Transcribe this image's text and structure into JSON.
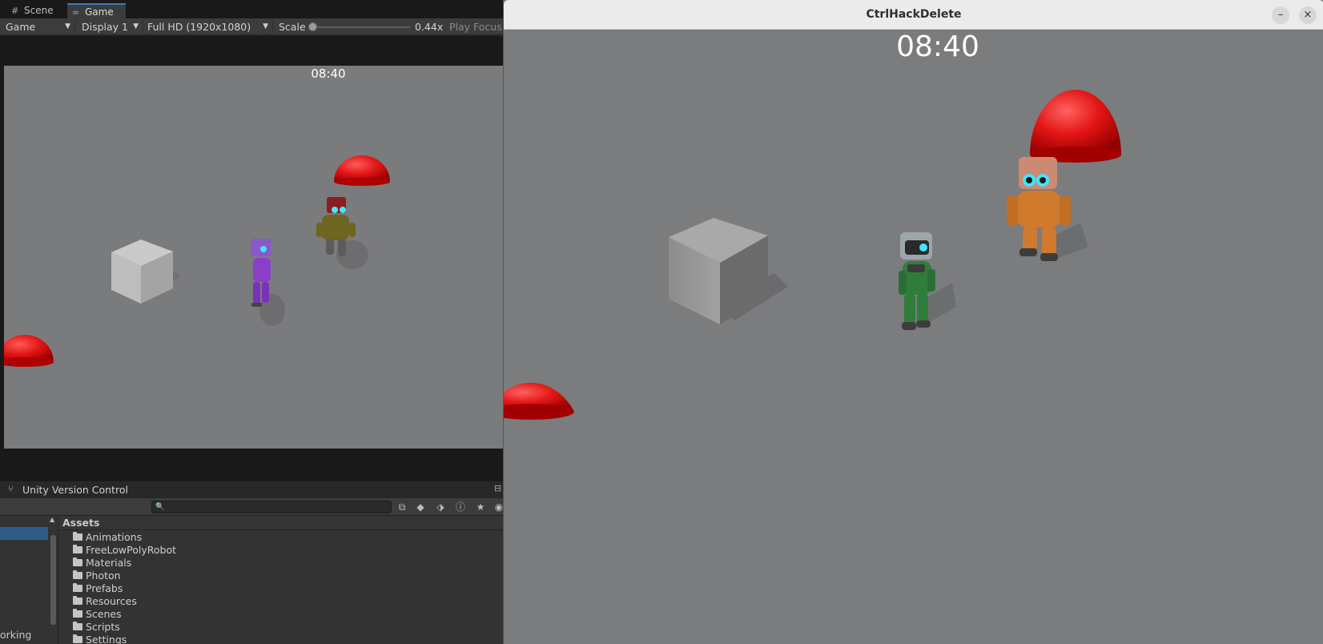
{
  "editor": {
    "tabs": [
      {
        "label": "Scene",
        "icon": "grid-icon"
      },
      {
        "label": "Game",
        "icon": "gamepad-icon"
      }
    ],
    "game_toolbar": {
      "mode": "Game",
      "display": "Display 1",
      "resolution": "Full HD (1920x1080)",
      "scale_label": "Scale",
      "scale_value": "0.44x",
      "play_focus": "Play Focus"
    },
    "game_view": {
      "timer": "08:40"
    }
  },
  "version_control": {
    "title": "Unity Version Control"
  },
  "project": {
    "tree_status": "orking",
    "assets_title": "Assets",
    "folders": [
      "Animations",
      "FreeLowPolyRobot",
      "Materials",
      "Photon",
      "Prefabs",
      "Resources",
      "Scenes",
      "Scripts",
      "Settings"
    ]
  },
  "game_window": {
    "title": "CtrlHackDelete",
    "timer": "08:40",
    "minimize_label": "–",
    "close_label": "×"
  },
  "colors": {
    "accent": "#3a79bb",
    "selection": "#2c5d87",
    "dome_red": "#e01212",
    "robot_purple": "#8a3fc8",
    "robot_olive": "#7a7020",
    "robot_green": "#2e7d3a",
    "robot_orange": "#d07a2e"
  }
}
